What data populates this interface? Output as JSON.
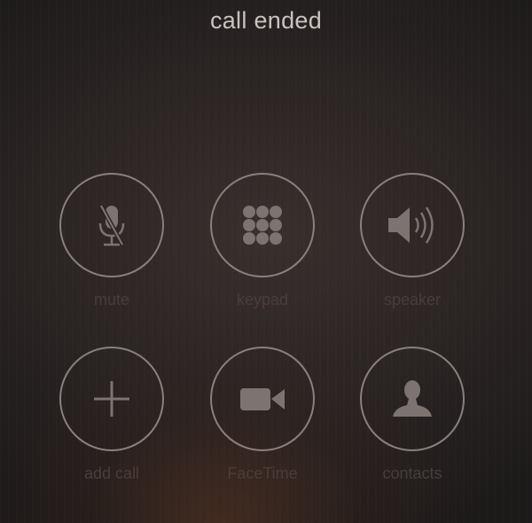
{
  "call": {
    "status": "call ended"
  },
  "controls": [
    {
      "label": "mute",
      "icon": "microphone-muted-icon"
    },
    {
      "label": "keypad",
      "icon": "keypad-icon"
    },
    {
      "label": "speaker",
      "icon": "speaker-icon"
    },
    {
      "label": "add call",
      "icon": "plus-icon"
    },
    {
      "label": "FaceTime",
      "icon": "video-camera-icon"
    },
    {
      "label": "contacts",
      "icon": "person-icon"
    }
  ],
  "colors": {
    "ring": "#8a807d",
    "icon": "#7d7370",
    "label": "#4a3d39",
    "status_text": "#c9c3c0"
  }
}
